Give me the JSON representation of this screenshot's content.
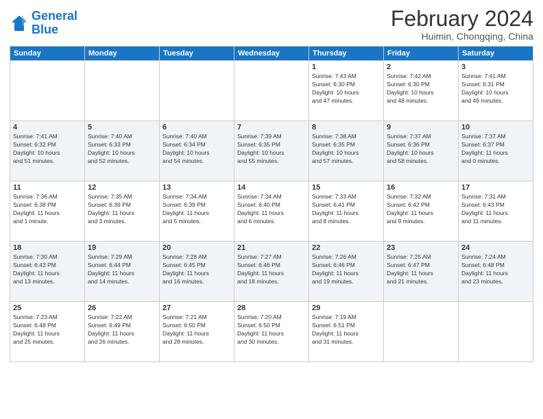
{
  "header": {
    "logo": {
      "line1": "General",
      "line2": "Blue"
    },
    "title": "February 2024",
    "subtitle": "Huimin, Chongqing, China"
  },
  "days_of_week": [
    "Sunday",
    "Monday",
    "Tuesday",
    "Wednesday",
    "Thursday",
    "Friday",
    "Saturday"
  ],
  "weeks": [
    [
      {
        "day": "",
        "info": ""
      },
      {
        "day": "",
        "info": ""
      },
      {
        "day": "",
        "info": ""
      },
      {
        "day": "",
        "info": ""
      },
      {
        "day": "1",
        "info": "Sunrise: 7:43 AM\nSunset: 6:30 PM\nDaylight: 10 hours\nand 47 minutes."
      },
      {
        "day": "2",
        "info": "Sunrise: 7:42 AM\nSunset: 6:30 PM\nDaylight: 10 hours\nand 48 minutes."
      },
      {
        "day": "3",
        "info": "Sunrise: 7:41 AM\nSunset: 6:31 PM\nDaylight: 10 hours\nand 49 minutes."
      }
    ],
    [
      {
        "day": "4",
        "info": "Sunrise: 7:41 AM\nSunset: 6:32 PM\nDaylight: 10 hours\nand 51 minutes."
      },
      {
        "day": "5",
        "info": "Sunrise: 7:40 AM\nSunset: 6:33 PM\nDaylight: 10 hours\nand 52 minutes."
      },
      {
        "day": "6",
        "info": "Sunrise: 7:40 AM\nSunset: 6:34 PM\nDaylight: 10 hours\nand 54 minutes."
      },
      {
        "day": "7",
        "info": "Sunrise: 7:39 AM\nSunset: 6:35 PM\nDaylight: 10 hours\nand 55 minutes."
      },
      {
        "day": "8",
        "info": "Sunrise: 7:38 AM\nSunset: 6:35 PM\nDaylight: 10 hours\nand 57 minutes."
      },
      {
        "day": "9",
        "info": "Sunrise: 7:37 AM\nSunset: 6:36 PM\nDaylight: 10 hours\nand 58 minutes."
      },
      {
        "day": "10",
        "info": "Sunrise: 7:37 AM\nSunset: 6:37 PM\nDaylight: 11 hours\nand 0 minutes."
      }
    ],
    [
      {
        "day": "11",
        "info": "Sunrise: 7:36 AM\nSunset: 6:38 PM\nDaylight: 11 hours\nand 1 minute."
      },
      {
        "day": "12",
        "info": "Sunrise: 7:35 AM\nSunset: 6:39 PM\nDaylight: 11 hours\nand 3 minutes."
      },
      {
        "day": "13",
        "info": "Sunrise: 7:34 AM\nSunset: 6:39 PM\nDaylight: 11 hours\nand 5 minutes."
      },
      {
        "day": "14",
        "info": "Sunrise: 7:34 AM\nSunset: 6:40 PM\nDaylight: 11 hours\nand 6 minutes."
      },
      {
        "day": "15",
        "info": "Sunrise: 7:33 AM\nSunset: 6:41 PM\nDaylight: 11 hours\nand 8 minutes."
      },
      {
        "day": "16",
        "info": "Sunrise: 7:32 AM\nSunset: 6:42 PM\nDaylight: 11 hours\nand 9 minutes."
      },
      {
        "day": "17",
        "info": "Sunrise: 7:31 AM\nSunset: 6:43 PM\nDaylight: 11 hours\nand 11 minutes."
      }
    ],
    [
      {
        "day": "18",
        "info": "Sunrise: 7:30 AM\nSunset: 6:43 PM\nDaylight: 11 hours\nand 13 minutes."
      },
      {
        "day": "19",
        "info": "Sunrise: 7:29 AM\nSunset: 6:44 PM\nDaylight: 11 hours\nand 14 minutes."
      },
      {
        "day": "20",
        "info": "Sunrise: 7:28 AM\nSunset: 6:45 PM\nDaylight: 11 hours\nand 16 minutes."
      },
      {
        "day": "21",
        "info": "Sunrise: 7:27 AM\nSunset: 6:46 PM\nDaylight: 11 hours\nand 18 minutes."
      },
      {
        "day": "22",
        "info": "Sunrise: 7:26 AM\nSunset: 6:46 PM\nDaylight: 11 hours\nand 19 minutes."
      },
      {
        "day": "23",
        "info": "Sunrise: 7:25 AM\nSunset: 6:47 PM\nDaylight: 11 hours\nand 21 minutes."
      },
      {
        "day": "24",
        "info": "Sunrise: 7:24 AM\nSunset: 6:48 PM\nDaylight: 11 hours\nand 23 minutes."
      }
    ],
    [
      {
        "day": "25",
        "info": "Sunrise: 7:23 AM\nSunset: 6:48 PM\nDaylight: 11 hours\nand 25 minutes."
      },
      {
        "day": "26",
        "info": "Sunrise: 7:22 AM\nSunset: 6:49 PM\nDaylight: 11 hours\nand 26 minutes."
      },
      {
        "day": "27",
        "info": "Sunrise: 7:21 AM\nSunset: 6:50 PM\nDaylight: 11 hours\nand 28 minutes."
      },
      {
        "day": "28",
        "info": "Sunrise: 7:20 AM\nSunset: 6:50 PM\nDaylight: 11 hours\nand 30 minutes."
      },
      {
        "day": "29",
        "info": "Sunrise: 7:19 AM\nSunset: 6:51 PM\nDaylight: 11 hours\nand 31 minutes."
      },
      {
        "day": "",
        "info": ""
      },
      {
        "day": "",
        "info": ""
      }
    ]
  ]
}
